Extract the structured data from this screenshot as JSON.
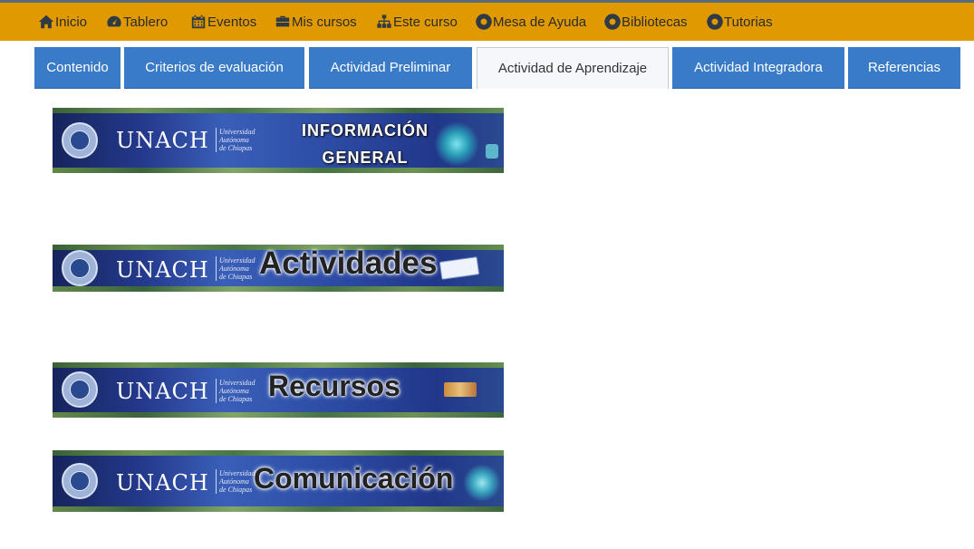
{
  "nav": {
    "items": [
      {
        "label": "Inicio",
        "icon": "home-icon"
      },
      {
        "label": "Tablero",
        "icon": "dashboard-icon"
      },
      {
        "label": "Eventos",
        "icon": "calendar-icon"
      },
      {
        "label": "Mis cursos",
        "icon": "briefcase-icon"
      },
      {
        "label": "Este curso",
        "icon": "sitemap-icon"
      },
      {
        "label": "Mesa de Ayuda",
        "icon": "lifering-icon"
      },
      {
        "label": "Bibliotecas",
        "icon": "lifering-icon"
      },
      {
        "label": "Tutorias",
        "icon": "lifering-icon"
      }
    ]
  },
  "tabs": [
    {
      "label": "Contenido",
      "active": false
    },
    {
      "label": "Criterios de evaluación",
      "active": false
    },
    {
      "label": "Actividad Preliminar",
      "active": false
    },
    {
      "label": "Actividad de Aprendizaje",
      "active": true
    },
    {
      "label": "Actividad Integradora",
      "active": false
    },
    {
      "label": "Referencias",
      "active": false
    }
  ],
  "banners": {
    "brand": "UNACH",
    "uni_line1": "Universidad",
    "uni_line2": "Autónoma",
    "uni_line3": "de Chiapas",
    "info_line1": "INFORMACIÓN",
    "info_line2": "GENERAL",
    "actividades": "Actividades",
    "recursos": "Recursos",
    "comunicacion": "Comunicación"
  },
  "colors": {
    "navbar": "#e09a00",
    "tab_blue": "#3a7bc8",
    "tab_active_bg": "#f5f7fa"
  }
}
